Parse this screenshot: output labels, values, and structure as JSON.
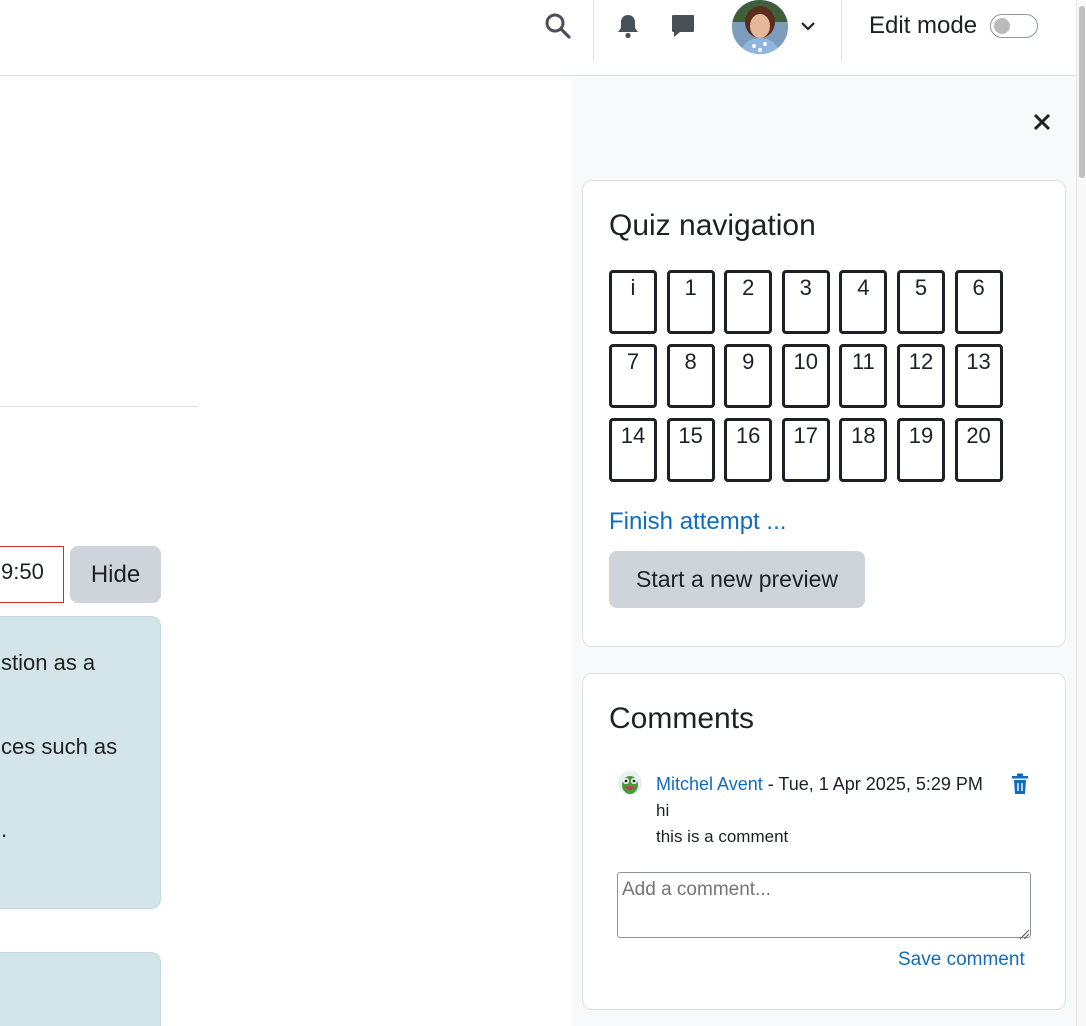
{
  "navbar": {
    "icons": [
      "search-icon",
      "bell-icon",
      "chat-icon",
      "chevron-down-icon"
    ],
    "edit_mode_label": "Edit mode",
    "edit_mode_on": false
  },
  "main": {
    "timer_fragment": "9:50",
    "hide_label": "Hide",
    "info_lines": [
      "stion as a",
      "ces such as",
      "."
    ]
  },
  "drawer": {
    "close_icon": "close-icon",
    "quiz_nav": {
      "title": "Quiz navigation",
      "buttons": [
        "i",
        "1",
        "2",
        "3",
        "4",
        "5",
        "6",
        "7",
        "8",
        "9",
        "10",
        "11",
        "12",
        "13",
        "14",
        "15",
        "16",
        "17",
        "18",
        "19",
        "20"
      ],
      "finish_label": "Finish attempt ...",
      "new_preview_label": "Start a new preview"
    },
    "comments": {
      "title": "Comments",
      "items": [
        {
          "author": "Mitchel Avent",
          "date": " - Tue, 1 Apr 2025, 5:29 PM",
          "lines": [
            "hi",
            "this is a comment"
          ]
        }
      ],
      "input_placeholder": "Add a comment...",
      "save_label": "Save comment"
    }
  },
  "colors": {
    "link": "#0f6cbf",
    "button_bg": "#ced4da",
    "info_bg": "#d3e5e8",
    "timer_border": "#ca3120"
  }
}
